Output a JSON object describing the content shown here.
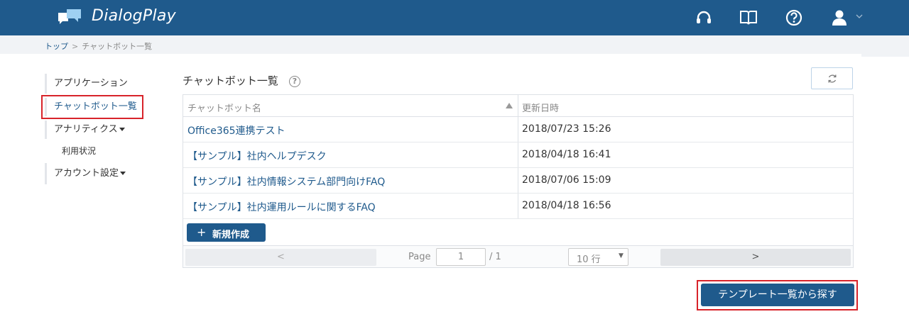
{
  "app": {
    "title": "DialogPlay"
  },
  "header": {
    "icons": [
      "headset-icon",
      "book-icon",
      "help-icon",
      "user-icon",
      "chevron-down-icon"
    ]
  },
  "breadcrumb": {
    "home": "トップ",
    "separator": ">",
    "current": "チャットボット一覧"
  },
  "sidebar": {
    "items": [
      {
        "label": "アプリケーション"
      },
      {
        "label": "チャットボット一覧",
        "active": true
      },
      {
        "label": "アナリティクス"
      },
      {
        "label": "利用状況"
      },
      {
        "label": "アカウント設定"
      }
    ]
  },
  "main": {
    "title": "チャットボット一覧",
    "table": {
      "columns": [
        "チャットボット名",
        "更新日時"
      ],
      "rows": [
        {
          "name": "Office365連携テスト",
          "updated": "2018/07/23 15:26"
        },
        {
          "name": "【サンプル】社内ヘルプデスク",
          "updated": "2018/04/18 16:41"
        },
        {
          "name": "【サンプル】社内情報システム部門向けFAQ",
          "updated": "2018/07/06 15:09"
        },
        {
          "name": "【サンプル】社内運用ルールに関するFAQ",
          "updated": "2018/04/18 16:56"
        }
      ]
    },
    "new_button": {
      "plus": "+",
      "label": "新規作成"
    },
    "pager": {
      "prev": "<",
      "next": ">",
      "page_label": "Page",
      "page_value": "1",
      "total": "/ 1",
      "per_page": "10 行"
    },
    "template_button": "テンプレート一覧から探す"
  },
  "colors": {
    "brand": "#1f5a8c",
    "highlight": "#d8232a"
  }
}
